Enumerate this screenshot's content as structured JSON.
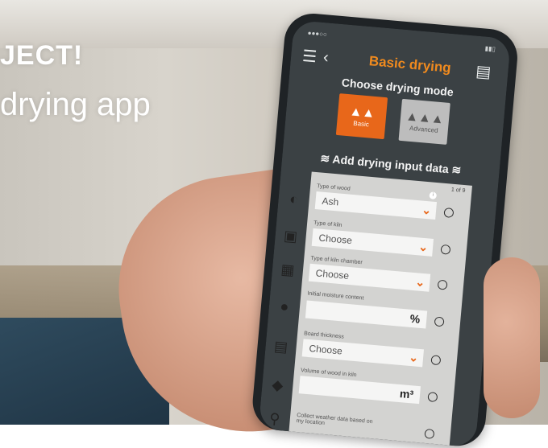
{
  "overlay": {
    "title": "JECT!",
    "subtitle": "drying app"
  },
  "app": {
    "title": "Basic drying",
    "mode_heading": "Choose drying mode",
    "modes": [
      {
        "label": "Basic",
        "color": "#e8671a",
        "selected": true
      },
      {
        "label": "Advanced",
        "color": "#bdbdbd",
        "selected": false
      }
    ],
    "input_heading": "Add drying input data",
    "step": "1 of 9",
    "fields": [
      {
        "label": "Type of wood",
        "value": "Ash",
        "control": "select"
      },
      {
        "label": "Type of kiln",
        "value": "Choose",
        "control": "select"
      },
      {
        "label": "Type of kiln chamber",
        "value": "Choose",
        "control": "select"
      },
      {
        "label": "Initial moisture content",
        "value": "%",
        "control": "number"
      },
      {
        "label": "Board thickness",
        "value": "Choose",
        "control": "select"
      },
      {
        "label": "Volume of wood in kiln",
        "value": "m³",
        "control": "number"
      },
      {
        "label": "Collect weather data based on my location",
        "value": "",
        "control": "toggle"
      }
    ]
  }
}
